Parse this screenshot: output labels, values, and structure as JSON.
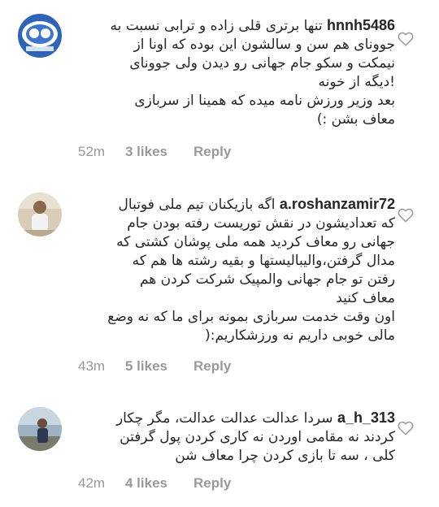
{
  "comments": [
    {
      "username": "hnnh5486",
      "text": "تنها برتری قلی زاده و ترابی نسبت به\nجوونای هم سن و سالشون این بوده که اونا از\nنیمکت و سکو جام جهانی رو دیدن ولی جوونای\n!دیگه از خونه\nبعد وزیر ورزش نامه میده که همینا از سربازی\nمعاف بشن :)",
      "time": "52m",
      "likes": "3 likes",
      "reply": "Reply"
    },
    {
      "username": "a.roshanzamir72",
      "text": "اگه بازیکنان تیم ملی فوتبال\nکه تعدادیشون در نقش توریست رفته بودن جام\nجهانی رو معاف کردید همه ملی پوشان کشتی که\nمدال گرفتن،والیبالیستها و بقیه رشته ها هم که\nرفتن تو جام جهانی والمپیک شرکت کردن هم\nمعاف کنید\nاون وقت خدمت سربازی بمونه برای ما که نه وضع\nمالی خوبی داریم نه ورزشکاریم:(",
      "time": "43m",
      "likes": "5 likes",
      "reply": "Reply"
    },
    {
      "username": "a_h_313",
      "text": "سردا عدالت عدالت عدالت، مگر چکار\nکردند نه مقامی اوردن نه کاری کردن پول گرفتن\nکلی ، سه تا بازی کردن چرا معاف شن",
      "time": "42m",
      "likes": "4 likes",
      "reply": "Reply"
    }
  ]
}
